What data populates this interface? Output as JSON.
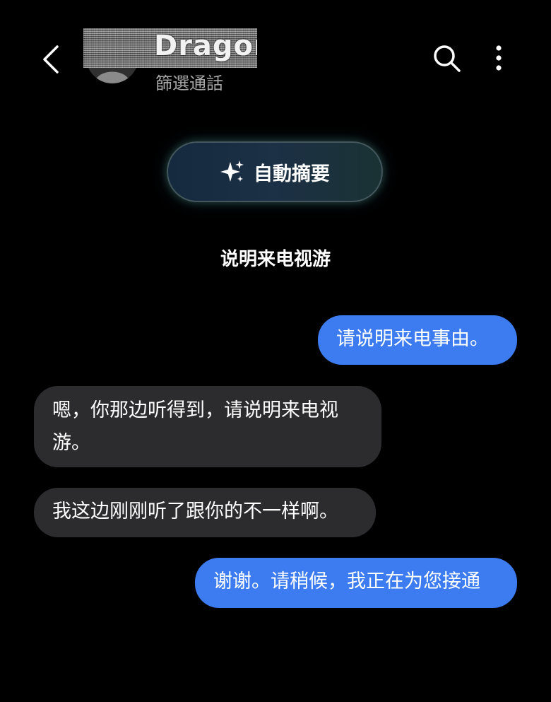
{
  "header": {
    "back_icon": "chevron-left-icon",
    "contact_name": "Dragon",
    "subtitle": "篩選通話",
    "search_icon": "search-icon",
    "more_icon": "more-vert-icon"
  },
  "summary_button": {
    "icon": "sparkle-icon",
    "label": "自動摘要"
  },
  "call_topic": "说明来电视游",
  "messages": [
    {
      "direction": "outgoing",
      "text": "请说明来电事由。"
    },
    {
      "direction": "incoming",
      "text": "嗯，你那边听得到，请说明来电视游。"
    },
    {
      "direction": "incoming",
      "text": "我这边刚刚听了跟你的不一样啊。"
    },
    {
      "direction": "outgoing",
      "text": "谢谢。请稍候，我正在为您接通"
    }
  ],
  "colors": {
    "background": "#000000",
    "outgoing_bubble": "#3c7cf0",
    "incoming_bubble": "#2c2c2e",
    "subtitle": "#a5a5a5"
  }
}
